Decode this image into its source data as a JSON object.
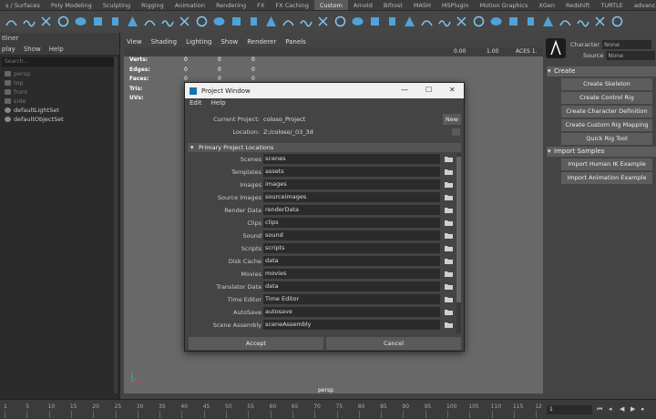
{
  "shelf_tabs": [
    "s / Surfaces",
    "Poly Modeling",
    "Sculpting",
    "Rigging",
    "Animation",
    "Rendering",
    "FX",
    "FX Caching",
    "Custom",
    "Arnold",
    "Bifrost",
    "MASH",
    "MSPlugin",
    "Motion Graphics",
    "XGen",
    "Redshift",
    "TURTLE",
    "advanced"
  ],
  "shelf_active_tab": "Custom",
  "outliner": {
    "title": "tliner",
    "menu": [
      "play",
      "Show",
      "Help"
    ],
    "search_placeholder": "Search...",
    "items": [
      {
        "label": "persp",
        "dim": true
      },
      {
        "label": "top",
        "dim": true
      },
      {
        "label": "front",
        "dim": true
      },
      {
        "label": "side",
        "dim": true
      },
      {
        "label": "defaultLightSet",
        "dim": false
      },
      {
        "label": "defaultObjectSet",
        "dim": false
      }
    ]
  },
  "viewport": {
    "menu": [
      "View",
      "Shading",
      "Lighting",
      "Show",
      "Renderer",
      "Panels"
    ],
    "toolbar_value_1": "0.00",
    "toolbar_value_2": "1.00",
    "colorspace": "ACES 1.",
    "hud": [
      {
        "label": "Verts:",
        "v1": "0",
        "v2": "0",
        "v3": "0"
      },
      {
        "label": "Edges:",
        "v1": "0",
        "v2": "0",
        "v3": "0"
      },
      {
        "label": "Faces:",
        "v1": "0",
        "v2": "0",
        "v3": "0"
      },
      {
        "label": "Tris:",
        "v1": "0",
        "v2": "0",
        "v3": "0"
      },
      {
        "label": "UVs:",
        "v1": "0",
        "v2": "0",
        "v3": "0"
      }
    ],
    "camera": "persp"
  },
  "right_panel": {
    "character_label": "Character",
    "character_value": "None",
    "source_label": "Source",
    "source_value": "None",
    "create_section": "Create",
    "create_buttons": [
      "Create Skeleton",
      "Create Control Rig",
      "Create Character Definition",
      "Create Custom Rig Mapping",
      "Quick Rig Tool"
    ],
    "samples_section": "Import Samples",
    "sample_buttons": [
      "Import Human IK Example",
      "Import Animation Example"
    ]
  },
  "timeline": {
    "ticks": [
      "1",
      "5",
      "10",
      "15",
      "20",
      "25",
      "30",
      "35",
      "40",
      "45",
      "50",
      "55",
      "60",
      "65",
      "70",
      "75",
      "80",
      "85",
      "90",
      "95",
      "100",
      "105",
      "110",
      "115",
      "12"
    ],
    "current_frame": "1"
  },
  "dialog": {
    "title": "Project Window",
    "menu": [
      "Edit",
      "Help"
    ],
    "current_project_label": "Current Project:",
    "current_project_value": "coloso_Project",
    "new_button": "New",
    "location_label": "Location:",
    "location_value": "Z:/coloso/_03_3d",
    "section_title": "Primary Project Locations",
    "locations": [
      {
        "label": "Scenes",
        "value": "scenes"
      },
      {
        "label": "Templates",
        "value": "assets"
      },
      {
        "label": "Images",
        "value": "images"
      },
      {
        "label": "Source Images",
        "value": "sourceimages"
      },
      {
        "label": "Render Data",
        "value": "renderData"
      },
      {
        "label": "Clips",
        "value": "clips"
      },
      {
        "label": "Sound",
        "value": "sound"
      },
      {
        "label": "Scripts",
        "value": "scripts"
      },
      {
        "label": "Disk Cache",
        "value": "data"
      },
      {
        "label": "Movies",
        "value": "movies"
      },
      {
        "label": "Translator Data",
        "value": "data"
      },
      {
        "label": "Time Editor",
        "value": "Time Editor"
      },
      {
        "label": "AutoSave",
        "value": "autosave"
      },
      {
        "label": "Scene Assembly",
        "value": "sceneAssembly"
      }
    ],
    "accept_button": "Accept",
    "cancel_button": "Cancel"
  }
}
